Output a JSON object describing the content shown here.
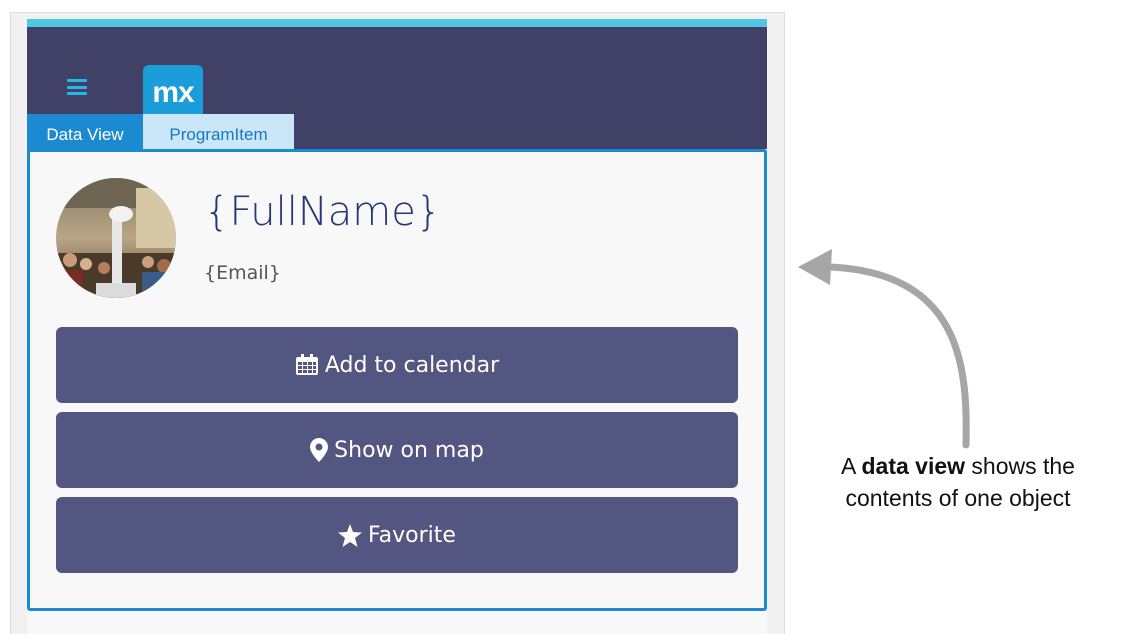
{
  "app": {
    "logo_text": "mx",
    "tag_widget": "Data View",
    "tag_entity": "ProgramItem"
  },
  "profile": {
    "fullname": "{FullName}",
    "email": "{Email}"
  },
  "buttons": {
    "add_calendar": "Add to calendar",
    "show_map": "Show on map",
    "favorite": "Favorite"
  },
  "annotation": {
    "prefix": "A ",
    "bold": "data view",
    "suffix": " shows the",
    "line2": "contents of one object"
  },
  "colors": {
    "accent_strip": "#4fc7e2",
    "navbar": "#414168",
    "dataview_border": "#1c8ad0",
    "button": "#535680",
    "title": "#263777"
  }
}
